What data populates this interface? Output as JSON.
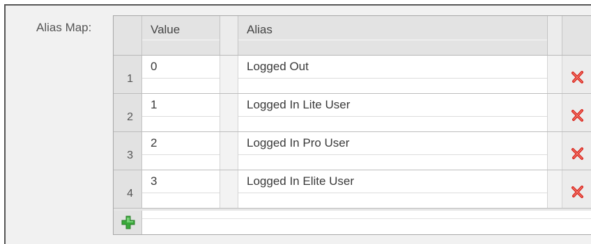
{
  "form": {
    "alias_map_label": "Alias Map:"
  },
  "table": {
    "columns": {
      "value": "Value",
      "alias": "Alias"
    },
    "rows": [
      {
        "index": "1",
        "value": "0",
        "alias": "Logged Out"
      },
      {
        "index": "2",
        "value": "1",
        "alias": "Logged In Lite User"
      },
      {
        "index": "3",
        "value": "2",
        "alias": "Logged In Pro User"
      },
      {
        "index": "4",
        "value": "3",
        "alias": "Logged In Elite User"
      }
    ],
    "row_action_icon": "delete-x-icon",
    "add_icon": "plus-icon"
  },
  "colors": {
    "delete_red": "#d9241c",
    "add_green": "#3aa83a"
  }
}
